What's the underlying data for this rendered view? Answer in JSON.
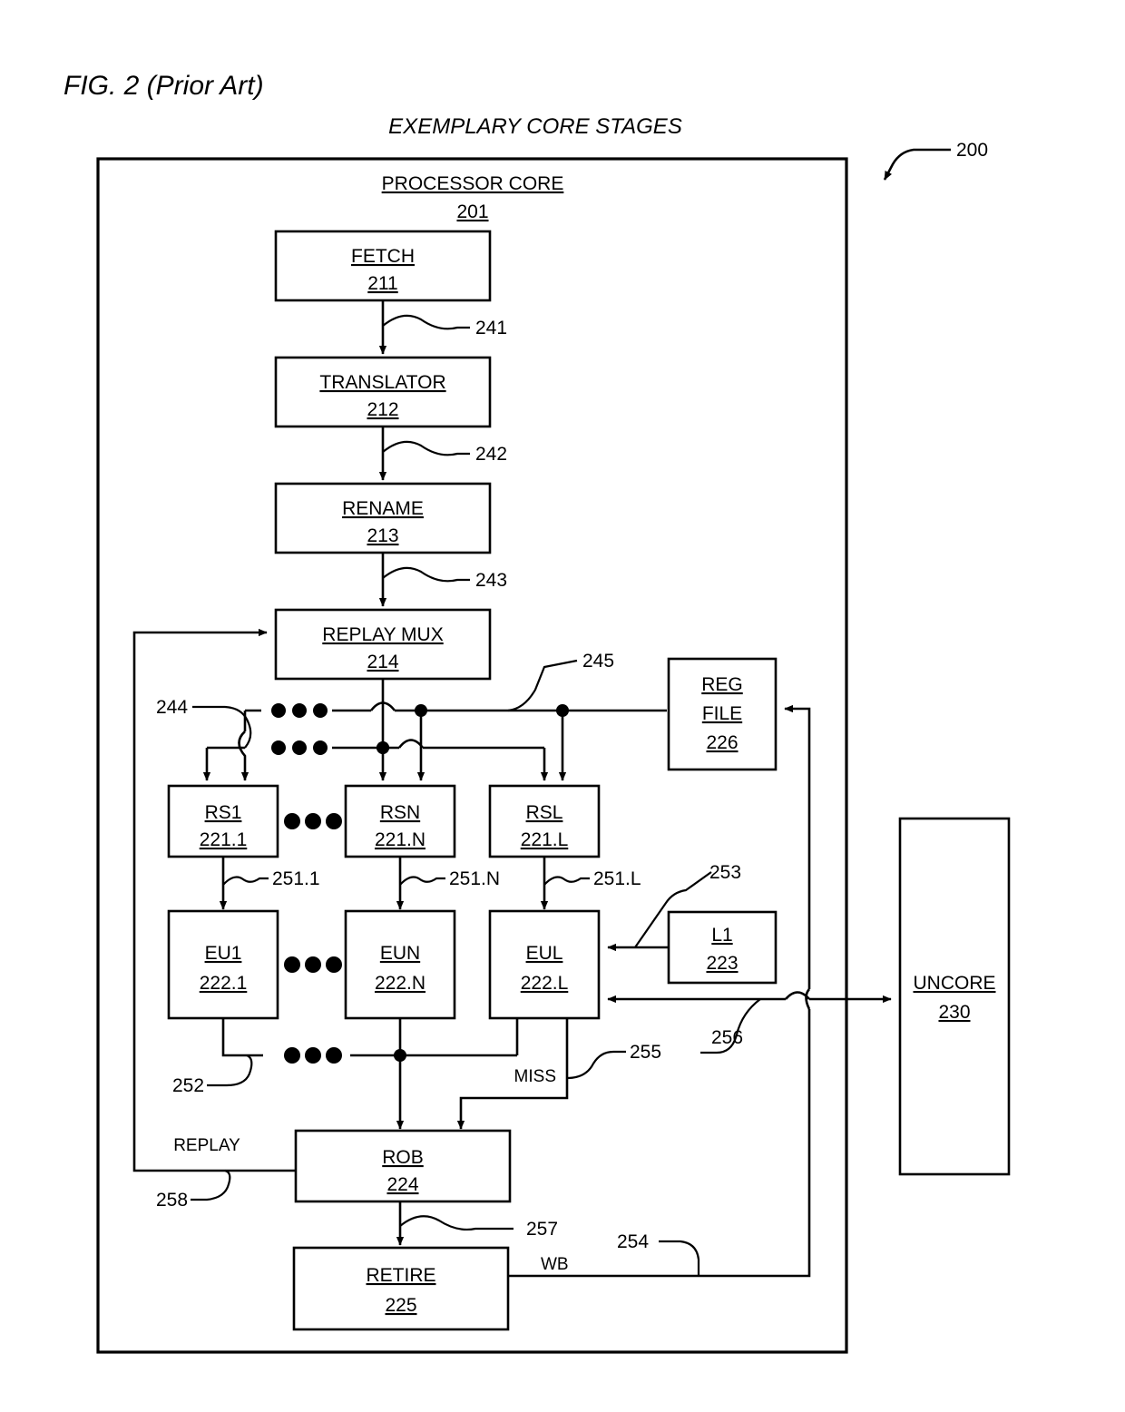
{
  "figure": {
    "label": "FIG. 2 (Prior Art)",
    "title": "EXEMPLARY CORE STAGES",
    "overall_ref": "200"
  },
  "container": {
    "name": "PROCESSOR CORE",
    "ref": "201"
  },
  "blocks": [
    {
      "id": "fetch",
      "name": "FETCH",
      "ref": "211"
    },
    {
      "id": "translator",
      "name": "TRANSLATOR",
      "ref": "212"
    },
    {
      "id": "rename",
      "name": "RENAME",
      "ref": "213"
    },
    {
      "id": "replaymux",
      "name": "REPLAY MUX",
      "ref": "214"
    },
    {
      "id": "rs1",
      "name": "RS1",
      "ref": "221.1"
    },
    {
      "id": "rsn",
      "name": "RSN",
      "ref": "221.N"
    },
    {
      "id": "rsl",
      "name": "RSL",
      "ref": "221.L"
    },
    {
      "id": "eu1",
      "name": "EU1",
      "ref": "222.1"
    },
    {
      "id": "eun",
      "name": "EUN",
      "ref": "222.N"
    },
    {
      "id": "eul",
      "name": "EUL",
      "ref": "222.L"
    },
    {
      "id": "l1",
      "name": "L1",
      "ref": "223"
    },
    {
      "id": "rob",
      "name": "ROB",
      "ref": "224"
    },
    {
      "id": "retire",
      "name": "RETIRE",
      "ref": "225"
    },
    {
      "id": "regfile",
      "name": "REG",
      "name2": "FILE",
      "ref": "226"
    },
    {
      "id": "uncore",
      "name": "UNCORE",
      "ref": "230"
    }
  ],
  "connector_refs": [
    {
      "id": "c241",
      "label": "241"
    },
    {
      "id": "c242",
      "label": "242"
    },
    {
      "id": "c243",
      "label": "243"
    },
    {
      "id": "c244",
      "label": "244"
    },
    {
      "id": "c245",
      "label": "245"
    },
    {
      "id": "c2511",
      "label": "251.1"
    },
    {
      "id": "c251n",
      "label": "251.N"
    },
    {
      "id": "c251l",
      "label": "251.L"
    },
    {
      "id": "c252",
      "label": "252"
    },
    {
      "id": "c253",
      "label": "253"
    },
    {
      "id": "c254",
      "label": "254"
    },
    {
      "id": "c255",
      "label": "255"
    },
    {
      "id": "c256",
      "label": "256"
    },
    {
      "id": "c257",
      "label": "257"
    },
    {
      "id": "c258",
      "label": "258"
    }
  ],
  "signal_labels": [
    {
      "id": "miss",
      "label": "MISS"
    },
    {
      "id": "replay",
      "label": "REPLAY"
    },
    {
      "id": "wb",
      "label": "WB"
    }
  ],
  "colors": {
    "stroke": "#000000",
    "background": "#ffffff"
  }
}
